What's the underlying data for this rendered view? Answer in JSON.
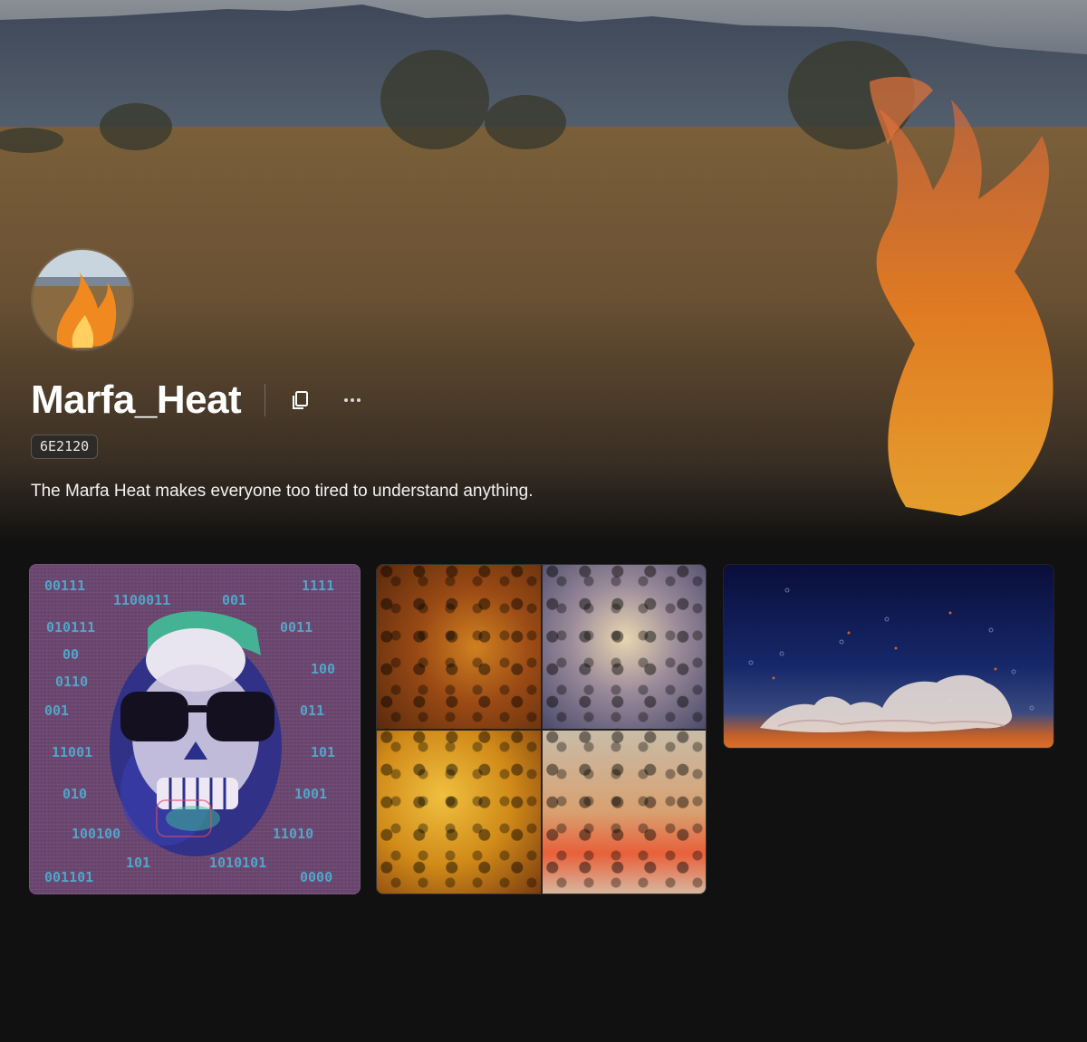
{
  "profile": {
    "name": "Marfa_Heat",
    "id_badge": "6E2120",
    "bio": "The Marfa Heat makes everyone too tired to understand anything."
  },
  "icons": {
    "copy": "copy-icon",
    "more": "more-icon"
  },
  "gallery": {
    "card1": {
      "binary_labels": [
        "00111",
        "1100011",
        "001",
        "1111",
        "010111",
        "0011",
        "00",
        "100",
        "0110",
        "001",
        "011",
        "11001",
        "101",
        "010",
        "1001",
        "100100",
        "11010",
        "101",
        "1010101",
        "001101",
        "0000"
      ]
    }
  },
  "colors": {
    "background": "#111111",
    "card1_bg": "#6b4670",
    "binary_text": "#4fb5d8"
  }
}
